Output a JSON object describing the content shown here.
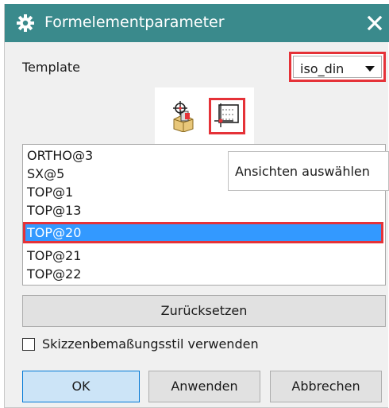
{
  "window": {
    "title": "Formelementparameter",
    "title_bar_color": "#3a8a8c",
    "icon": "gear-icon",
    "close_icon": "close-icon"
  },
  "template": {
    "label": "Template",
    "selected": "iso_din"
  },
  "toolbar": {
    "buttons": [
      {
        "icon": "select-model-icon"
      },
      {
        "icon": "select-views-icon",
        "highlighted": true
      }
    ]
  },
  "tooltip": {
    "text": "Ansichten auswählen"
  },
  "views": {
    "items": [
      "ORTHO@3",
      "SX@5",
      "TOP@1",
      "TOP@13",
      "TOP@20",
      "TOP@21",
      "TOP@22"
    ],
    "selected_index": 4
  },
  "reset_label": "Zurücksetzen",
  "sketch_style": {
    "label": "Skizzenbemaßungsstil verwenden",
    "checked": false
  },
  "footer": {
    "ok": "OK",
    "apply": "Anwenden",
    "cancel": "Abbrechen"
  },
  "colors": {
    "highlight_red": "#e53238",
    "selection_blue": "#3399ff",
    "ok_blue": "#cce4f7"
  }
}
